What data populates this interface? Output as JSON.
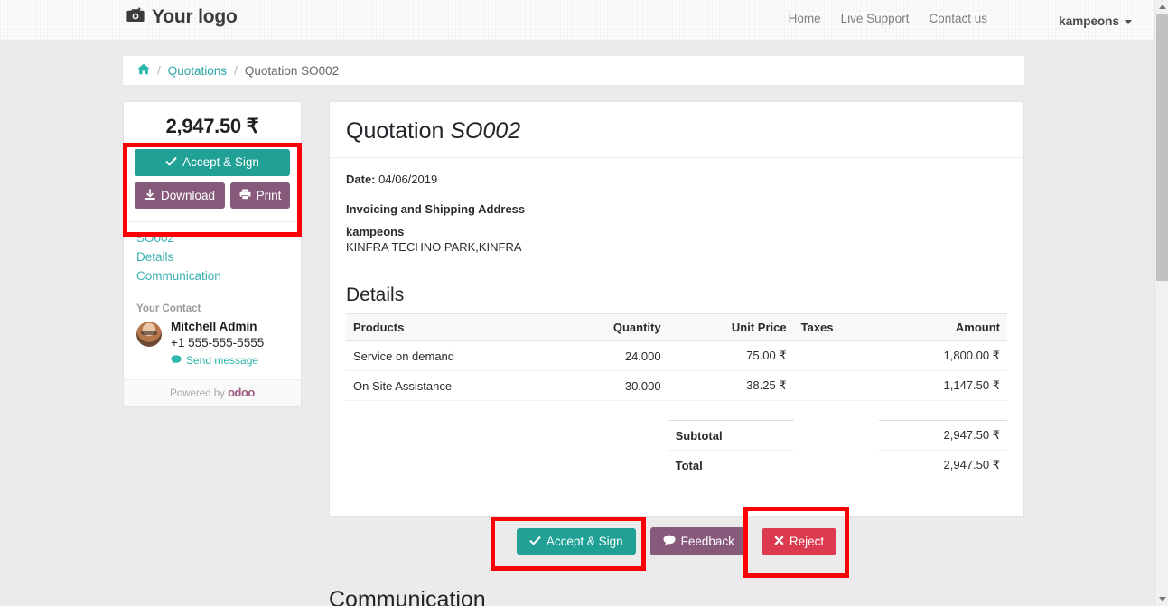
{
  "header": {
    "logo_text": "Your logo",
    "logo_icon": "camera-icon",
    "nav": [
      {
        "label": "Home"
      },
      {
        "label": "Live Support"
      },
      {
        "label": "Contact us"
      }
    ],
    "user": {
      "name": "kampeons",
      "caret_icon": "chevron-down-icon"
    }
  },
  "breadcrumb": {
    "home_icon": "home-icon",
    "separator": "/",
    "items": [
      {
        "label": "Quotations",
        "link": true
      },
      {
        "label": "Quotation SO002",
        "link": false
      }
    ]
  },
  "sidebar": {
    "amount": "2,947.50 ₹",
    "buttons": {
      "accept_sign": {
        "label": "Accept & Sign",
        "icon": "check-icon",
        "color": "#21a196"
      },
      "download": {
        "label": "Download",
        "icon": "download-icon",
        "color": "#875a7b"
      },
      "print": {
        "label": "Print",
        "icon": "printer-icon",
        "color": "#875a7b"
      }
    },
    "links": [
      {
        "label": "SO002"
      },
      {
        "label": "Details"
      },
      {
        "label": "Communication"
      }
    ],
    "contact": {
      "section_label": "Your Contact",
      "avatar_icon": "avatar",
      "name": "Mitchell Admin",
      "phone": "+1 555-555-5555",
      "send_message": {
        "label": "Send message",
        "icon": "comment-icon"
      }
    },
    "footer": {
      "powered_by": "Powered by",
      "brand": "odoo"
    }
  },
  "main": {
    "title_prefix": "Quotation ",
    "title_ref": "SO002",
    "date_label": "Date:",
    "date_value": "04/06/2019",
    "address_heading": "Invoicing and Shipping Address",
    "address_name": "kampeons",
    "address_line": "KINFRA TECHNO PARK,KINFRA",
    "details_heading": "Details",
    "table": {
      "columns": [
        "Products",
        "Quantity",
        "Unit Price",
        "Taxes",
        "Amount"
      ],
      "rows": [
        {
          "product": "Service on demand",
          "quantity": "24.000",
          "unit_price": "75.00 ₹",
          "taxes": "",
          "amount": "1,800.00 ₹"
        },
        {
          "product": "On Site Assistance",
          "quantity": "30.000",
          "unit_price": "38.25 ₹",
          "taxes": "",
          "amount": "1,147.50 ₹"
        }
      ],
      "totals": [
        {
          "label": "Subtotal",
          "value": "2,947.50 ₹"
        },
        {
          "label": "Total",
          "value": "2,947.50 ₹"
        }
      ]
    }
  },
  "actions": {
    "accept_sign": {
      "label": "Accept & Sign",
      "icon": "check-icon",
      "color": "#21a196"
    },
    "feedback": {
      "label": "Feedback",
      "icon": "comment-icon",
      "color": "#875a7b"
    },
    "reject": {
      "label": "Reject",
      "icon": "x-icon",
      "color": "#dc3a4f"
    }
  },
  "below_fold": {
    "heading": "Communication"
  },
  "annotations": {
    "color": "#fb0007",
    "boxes": [
      {
        "name": "sidebar-actions-highlight"
      },
      {
        "name": "accept-sign-highlight"
      },
      {
        "name": "reject-highlight"
      }
    ]
  },
  "scrollbar": {
    "up_icon": "triangle-up-icon",
    "down_icon": "triangle-down-icon"
  }
}
